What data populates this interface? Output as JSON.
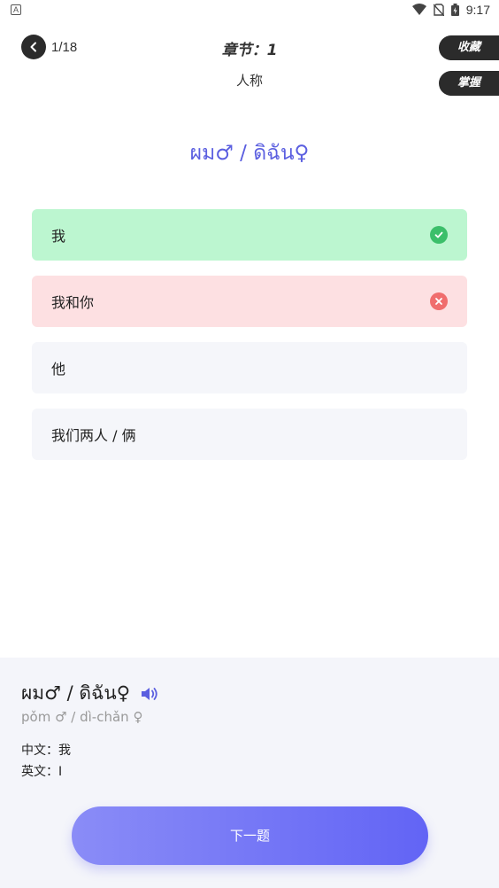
{
  "status_bar": {
    "notification_icon": "a-icon",
    "time": "9:17"
  },
  "header": {
    "progress": "1/18",
    "chapter": "章节：1",
    "subtitle": "人称",
    "favorite_label": "收藏",
    "master_label": "掌握"
  },
  "question": {
    "text": "ผม♂ / ดิฉัน♀"
  },
  "options": [
    {
      "label": "我",
      "state": "correct"
    },
    {
      "label": "我和你",
      "state": "wrong"
    },
    {
      "label": "他",
      "state": "none"
    },
    {
      "label": "我们两人 / 俩",
      "state": "none"
    }
  ],
  "detail": {
    "word": "ผม♂ / ดิฉัน♀",
    "romanization": "pǒm ♂ / dì-chǎn ♀",
    "chinese": "中文：我",
    "english": "英文：I"
  },
  "next_button": {
    "label": "下一题"
  },
  "colors": {
    "accent": "#5b5fe0",
    "correct_bg": "#bcf6d0",
    "wrong_bg": "#fde0e2",
    "correct_icon": "#3bbf6a",
    "wrong_icon": "#f06d6d"
  }
}
